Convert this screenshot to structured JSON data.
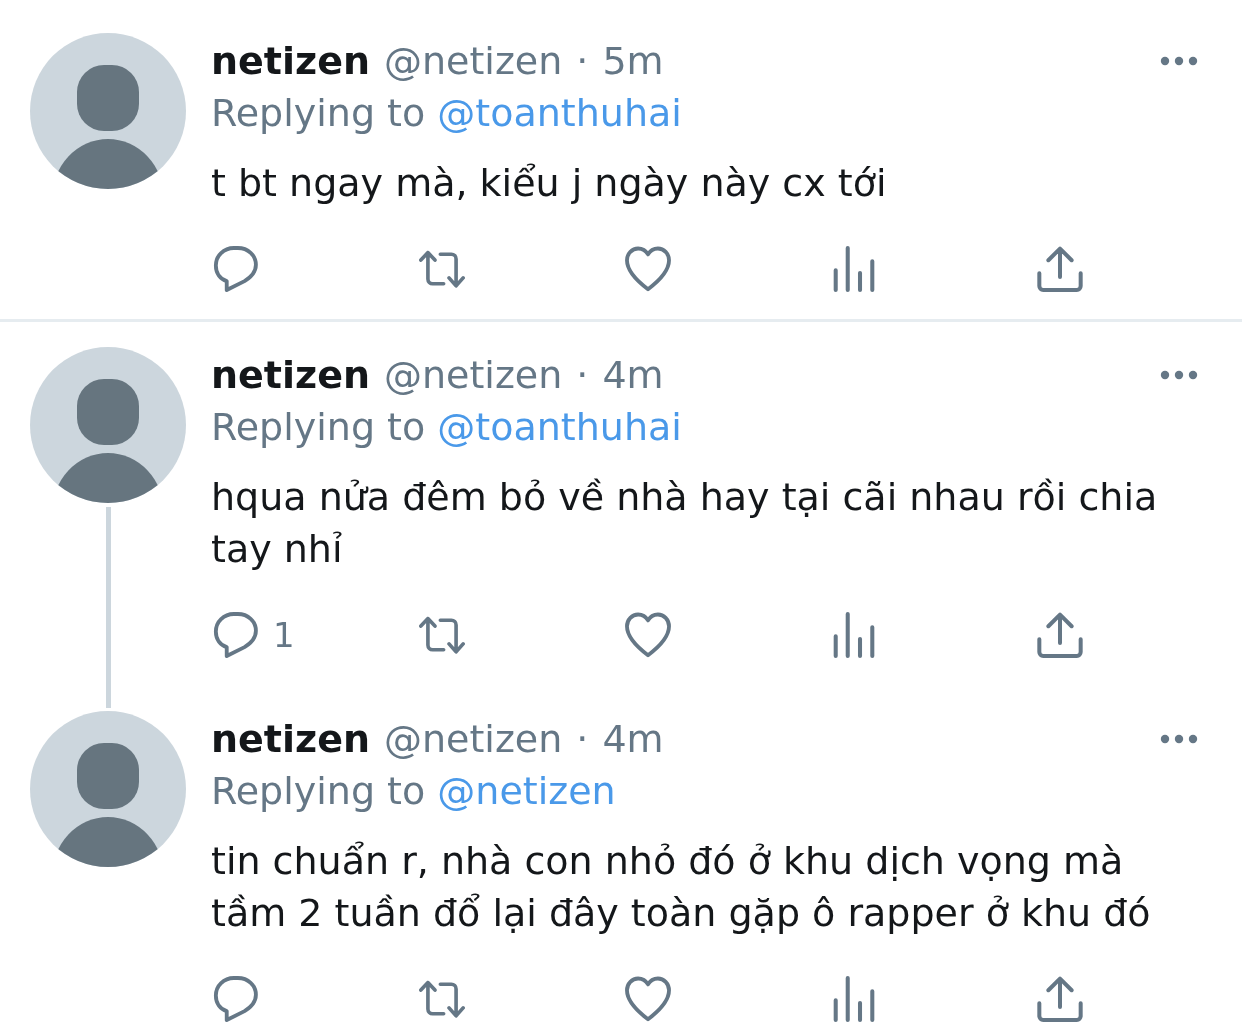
{
  "tweets": [
    {
      "name": "netizen",
      "handle": "@netizen",
      "separator": "·",
      "time": "5m",
      "reply_label": "Replying to",
      "reply_to": "@toanthuhai",
      "text": "t bt ngay mà, kiểu j ngày này cx tới",
      "actions": [
        {
          "kind": "reply"
        },
        {
          "kind": "retweet"
        },
        {
          "kind": "like"
        },
        {
          "kind": "views"
        },
        {
          "kind": "share"
        }
      ],
      "thread_line_below": false,
      "divider_below": true
    },
    {
      "name": "netizen",
      "handle": "@netizen",
      "separator": "·",
      "time": "4m",
      "reply_label": "Replying to",
      "reply_to": "@toanthuhai",
      "text": "hqua nửa đêm bỏ về nhà hay tại cãi nhau rồi chia tay nhỉ",
      "actions": [
        {
          "kind": "reply",
          "count": "1"
        },
        {
          "kind": "retweet"
        },
        {
          "kind": "like"
        },
        {
          "kind": "views"
        },
        {
          "kind": "share"
        }
      ],
      "thread_line_below": true,
      "divider_below": false
    },
    {
      "name": "netizen",
      "handle": "@netizen",
      "separator": "·",
      "time": "4m",
      "reply_label": "Replying to",
      "reply_to": "@netizen",
      "text": "tin chuẩn r, nhà con nhỏ đó ở khu dịch vọng mà tầm 2 tuần đổ lại đây toàn gặp ô rapper ở khu đó",
      "actions": [
        {
          "kind": "reply"
        },
        {
          "kind": "retweet"
        },
        {
          "kind": "like"
        },
        {
          "kind": "views"
        },
        {
          "kind": "share"
        }
      ],
      "thread_line_below": false,
      "divider_below": false
    }
  ]
}
